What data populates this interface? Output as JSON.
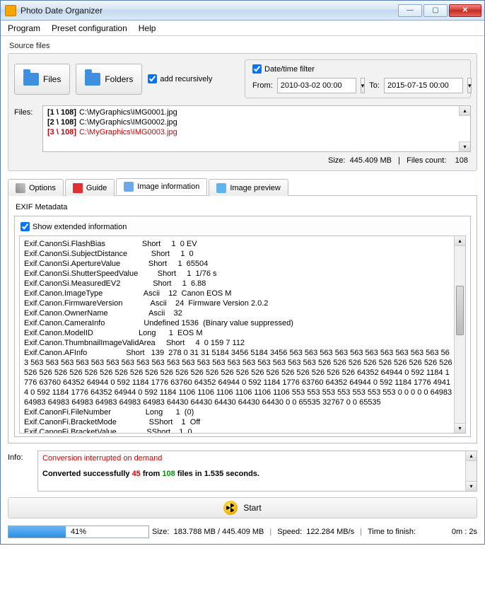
{
  "window": {
    "title": "Photo Date Organizer"
  },
  "menu": {
    "program": "Program",
    "preset": "Preset configuration",
    "help": "Help"
  },
  "source": {
    "label": "Source files",
    "files_btn": "Files",
    "folders_btn": "Folders",
    "recursive_label": "add recursively",
    "filter_label": "Date/time filter",
    "from_label": "From:",
    "to_label": "To:",
    "from_value": "2010-03-02 00:00",
    "to_value": "2015-07-15 00:00",
    "files_label": "Files:",
    "list": [
      {
        "index": "[1 \\ 108]",
        "path": "C:\\MyGraphics\\IMG0001.jpg",
        "red": false
      },
      {
        "index": "[2 \\ 108]",
        "path": "C:\\MyGraphics\\IMG0002.jpg",
        "red": false
      },
      {
        "index": "[3 \\ 108]",
        "path": "C:\\MyGraphics\\IMG0003.jpg",
        "red": true
      }
    ],
    "size_label": "Size:",
    "size_value": "445.409 MB",
    "count_label": "Files count:",
    "count_value": "108"
  },
  "tabs": {
    "options": "Options",
    "guide": "Guide",
    "imageinfo": "Image information",
    "preview": "Image preview"
  },
  "exif": {
    "title": "EXIF Metadata",
    "checkbox": "Show extended information",
    "text": "Exif.CanonSi.FlashBias                 Short     1  0 EV\nExif.CanonSi.SubjectDistance           Short     1  0\nExif.CanonSi.ApertureValue             Short     1  65504\nExif.CanonSi.ShutterSpeedValue         Short     1  1/76 s\nExif.CanonSi.MeasuredEV2               Short     1  6.88\nExif.Canon.ImageType                   Ascii    12  Canon EOS M\nExif.Canon.FirmwareVersion             Ascii    24  Firmware Version 2.0.2\nExif.Canon.OwnerName                   Ascii    32\nExif.Canon.CameraInfo                  Undefined 1536  (Binary value suppressed)\nExif.Canon.ModelID                     Long      1  EOS M\nExif.Canon.ThumbnailImageValidArea     Short     4  0 159 7 112\nExif.Canon.AFInfo                  Short   139  278 0 31 31 5184 3456 5184 3456 563 563 563 563 563 563 563 563 563 563 563 563 563 563 563 563 563 563 563 563 563 563 563 563 563 563 563 563 563 563 526 526 526 526 526 526 526 526 526 526 526 526 526 526 526 526 526 526 526 526 526 526 526 526 526 526 526 526 526 526 526 64352 64944 0 592 1184 1776 63760 64352 64944 0 592 1184 1776 63760 64352 64944 0 592 1184 1776 63760 64352 64944 0 592 1184 1776 49414 0 592 1184 1776 64352 64944 0 592 1184 1106 1106 1106 1106 1106 1106 553 553 553 553 553 553 553 0 0 0 0 0 64983 64983 64983 64983 64983 64983 64983 64430 64430 64430 64430 64430 0 0 65535 32767 0 0 65535\nExif.CanonFi.FileNumber                Long      1  (0)\nExif.CanonFi.BracketMode               SShort    1  Off\nExif.CanonFi.BracketValue              SShort    1  0"
  },
  "info": {
    "label": "Info:",
    "interrupted": "Conversion interrupted on demand",
    "s1": "Converted successfully ",
    "n1": "45",
    "s2": " from ",
    "n2": "108",
    "s3": " files in 1.535 seconds."
  },
  "start": {
    "label": "Start"
  },
  "status": {
    "percent": "41%",
    "percent_width": "41%",
    "size_label": "Size:",
    "size_value": "183.788 MB  /  445.409 MB",
    "speed_label": "Speed:",
    "speed_value": "122.284 MB/s",
    "ttf_label": "Time to finish:",
    "ttf_value": "0m : 2s"
  }
}
